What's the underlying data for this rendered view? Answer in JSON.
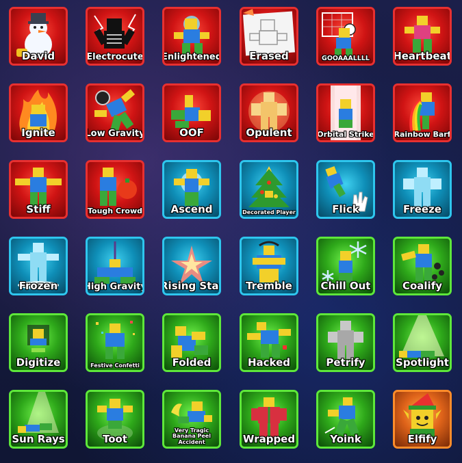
{
  "emotes": [
    {
      "label": "David",
      "theme": "red",
      "icon": "snowman-icon"
    },
    {
      "label": "Electrocute",
      "theme": "red",
      "icon": "skeleton-lightning-icon"
    },
    {
      "label": "Enlightened",
      "theme": "red",
      "icon": "glowing-orb-icon"
    },
    {
      "label": "Erased",
      "theme": "red",
      "icon": "paper-sketch-icon"
    },
    {
      "label": "GOOAAALLLL",
      "theme": "red",
      "icon": "soccer-goal-icon"
    },
    {
      "label": "Heartbeat",
      "theme": "red",
      "icon": "heartbeat-icon"
    },
    {
      "label": "Ignite",
      "theme": "red",
      "icon": "fire-icon"
    },
    {
      "label": "Low Gravity",
      "theme": "red",
      "icon": "astronaut-helmet-icon"
    },
    {
      "label": "OOF",
      "theme": "red",
      "icon": "fallen-avatar-icon"
    },
    {
      "label": "Opulent",
      "theme": "red",
      "icon": "golden-avatar-icon"
    },
    {
      "label": "Orbital Strike",
      "theme": "red",
      "icon": "light-beam-icon"
    },
    {
      "label": "Rainbow Barf",
      "theme": "red",
      "icon": "rainbow-icon"
    },
    {
      "label": "Stiff",
      "theme": "red",
      "icon": "t-pose-icon"
    },
    {
      "label": "Tough Crowd",
      "theme": "red",
      "icon": "tomato-icon"
    },
    {
      "label": "Ascend",
      "theme": "blue",
      "icon": "ascending-glow-icon"
    },
    {
      "label": "Decorated Player",
      "theme": "blue",
      "icon": "christmas-tree-icon"
    },
    {
      "label": "Flick",
      "theme": "blue",
      "icon": "flick-hand-icon"
    },
    {
      "label": "Freeze",
      "theme": "blue",
      "icon": "frozen-avatar-icon"
    },
    {
      "label": "Frozen",
      "theme": "blue",
      "icon": "ice-statue-icon"
    },
    {
      "label": "High Gravity",
      "theme": "blue",
      "icon": "gravity-icon"
    },
    {
      "label": "Rising Star",
      "theme": "blue",
      "icon": "star-burst-icon"
    },
    {
      "label": "Tremble",
      "theme": "blue",
      "icon": "trembling-avatar-icon"
    },
    {
      "label": "Chill Out",
      "theme": "green",
      "icon": "snowflake-icon"
    },
    {
      "label": "Coalify",
      "theme": "green",
      "icon": "coal-icon"
    },
    {
      "label": "Digitize",
      "theme": "green",
      "icon": "digital-cube-icon"
    },
    {
      "label": "Festive Confetti",
      "theme": "green",
      "icon": "confetti-icon"
    },
    {
      "label": "Folded",
      "theme": "green",
      "icon": "folded-avatar-icon"
    },
    {
      "label": "Hacked",
      "theme": "green",
      "icon": "glitch-avatar-icon"
    },
    {
      "label": "Petrify",
      "theme": "green",
      "icon": "stone-avatar-icon"
    },
    {
      "label": "Spotlight",
      "theme": "green",
      "icon": "spotlight-icon"
    },
    {
      "label": "Sun Rays",
      "theme": "green",
      "icon": "sun-rays-icon"
    },
    {
      "label": "Toot",
      "theme": "green",
      "icon": "gas-cloud-icon"
    },
    {
      "label": "Very Tragic Banana Peel Accident",
      "theme": "green",
      "icon": "banana-peel-icon"
    },
    {
      "label": "Wrapped",
      "theme": "green",
      "icon": "gift-wrap-icon"
    },
    {
      "label": "Yoink",
      "theme": "green",
      "icon": "yoink-hook-icon"
    },
    {
      "label": "Elfify",
      "theme": "orange",
      "icon": "elf-hat-icon"
    }
  ],
  "colors": {
    "red_border": "#e83030",
    "blue_border": "#2ec6ee",
    "green_border": "#5ee83a",
    "orange_border": "#ff8c2a",
    "label_text": "#ffffff"
  }
}
